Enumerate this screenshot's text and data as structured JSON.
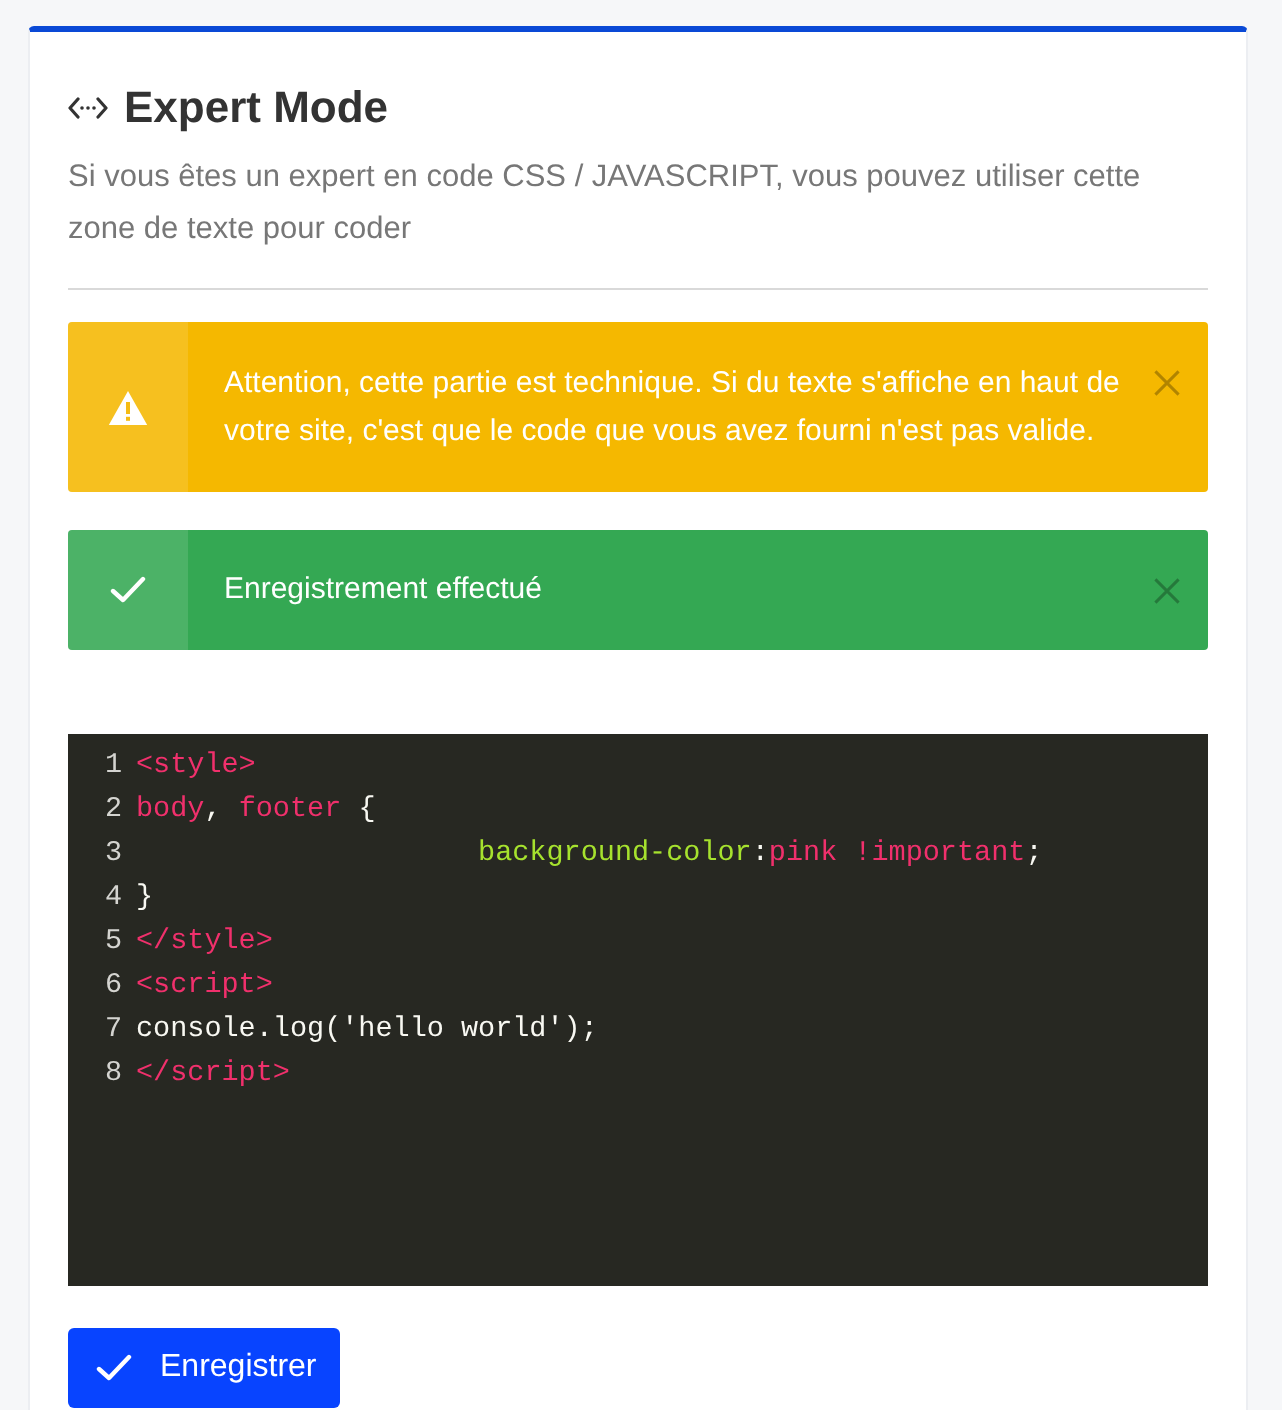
{
  "header": {
    "title": "Expert Mode",
    "description": "Si vous êtes un expert en code CSS / JAVASCRIPT, vous pouvez utiliser cette zone de texte pour coder"
  },
  "alerts": [
    {
      "kind": "warning",
      "message": "Attention, cette partie est technique. Si du texte s'affiche en haut de votre site, c'est que le code que vous avez fourni n'est pas valide.",
      "dismissible": true
    },
    {
      "kind": "success",
      "message": "Enregistrement effectué",
      "dismissible": true
    }
  ],
  "code_editor": {
    "lines": [
      {
        "number": "1",
        "tokens": [
          {
            "kind": "tag",
            "text": "<style>"
          }
        ]
      },
      {
        "number": "2",
        "tokens": [
          {
            "kind": "selector",
            "text": "body"
          },
          {
            "kind": "punct",
            "text": ", "
          },
          {
            "kind": "selector",
            "text": "footer"
          },
          {
            "kind": "punct",
            "text": " {"
          }
        ]
      },
      {
        "number": "3",
        "tokens": [
          {
            "kind": "property",
            "text": "                    background-color"
          },
          {
            "kind": "punct",
            "text": ":"
          },
          {
            "kind": "value",
            "text": "pink !important"
          },
          {
            "kind": "punct",
            "text": ";"
          }
        ]
      },
      {
        "number": "4",
        "tokens": [
          {
            "kind": "punct",
            "text": "}"
          }
        ]
      },
      {
        "number": "5",
        "tokens": [
          {
            "kind": "tag",
            "text": "</style>"
          }
        ]
      },
      {
        "number": "6",
        "tokens": [
          {
            "kind": "tag",
            "text": "<script>"
          }
        ]
      },
      {
        "number": "7",
        "tokens": [
          {
            "kind": "plain",
            "text": "console.log('hello world');"
          }
        ]
      },
      {
        "number": "8",
        "tokens": [
          {
            "kind": "tag",
            "text": "</script>"
          }
        ]
      }
    ]
  },
  "save_button": {
    "label": "Enregistrer"
  }
}
